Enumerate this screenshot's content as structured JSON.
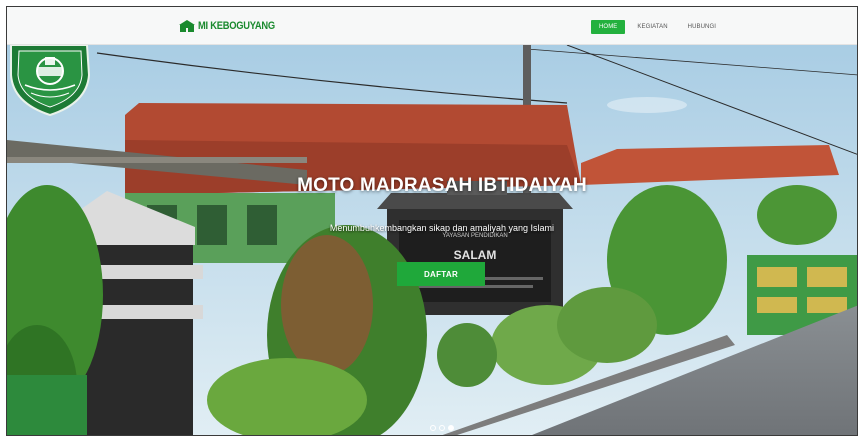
{
  "navbar": {
    "brand_text": "MI KEBOGUYANG",
    "menu": [
      {
        "label": "HOME",
        "active": true
      },
      {
        "label": "KEGIATAN",
        "active": false
      },
      {
        "label": "HUBUNGI",
        "active": false
      }
    ]
  },
  "hero": {
    "title": "MOTO MADRASAH IBTIDAIYAH",
    "subtitle": "Menumbuhkembangkan sikap dan amaliyah yang Islami",
    "cta_label": "DAFTAR",
    "slides_total": 3,
    "active_slide": 3
  },
  "colors": {
    "brand_green": "#1a8a2e",
    "button_green": "#1fa83a",
    "nav_active": "#23b13e"
  }
}
